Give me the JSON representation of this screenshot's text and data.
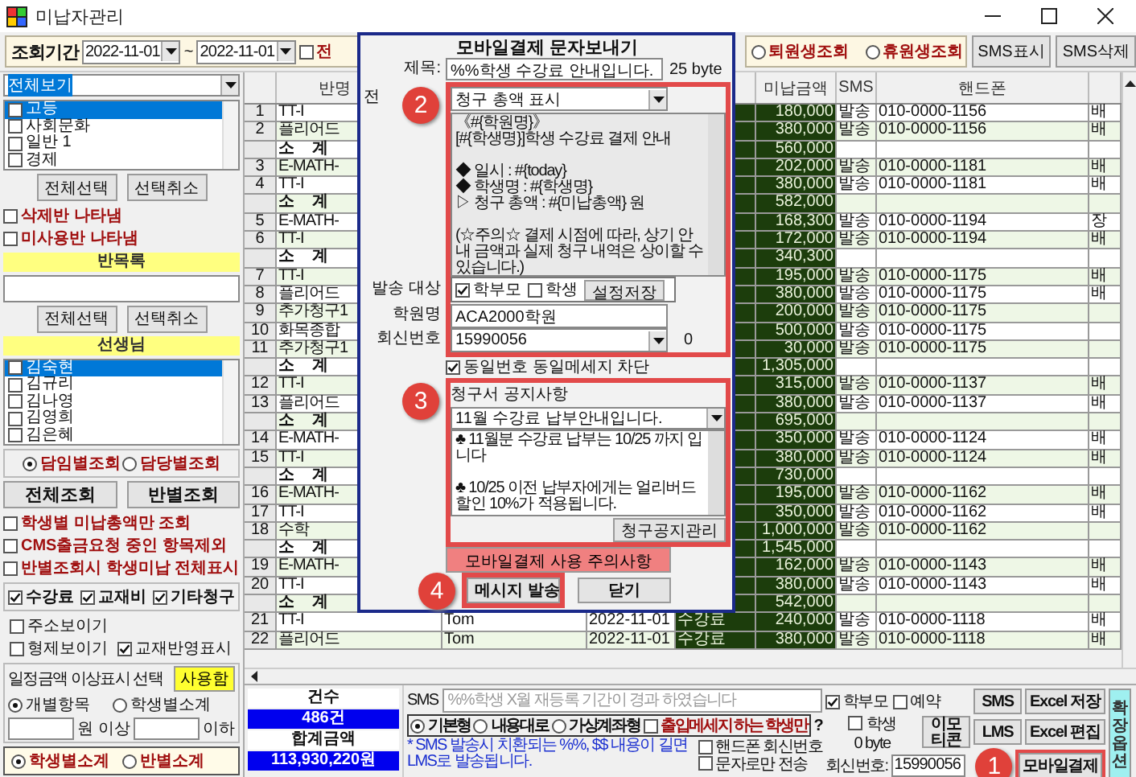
{
  "window": {
    "title": "미납자관리"
  },
  "toolbar": {
    "period_label": "조회기간",
    "date_from": "2022-11-01",
    "date_separator": "~",
    "date_to": "2022-11-01",
    "checkbox": {
      "label": "전",
      "checked": false
    },
    "radios": [
      {
        "label": "퇴원생조회",
        "selected": false
      },
      {
        "label": "휴원생조회",
        "selected": false
      }
    ],
    "buttons": [
      "SMS표시",
      "SMS삭제"
    ]
  },
  "left": {
    "filter": "전체보기",
    "subjects": [
      {
        "label": "고등",
        "checked": false,
        "selected": true
      },
      {
        "label": "사회문화",
        "checked": false,
        "selected": false
      },
      {
        "label": "일반 1",
        "checked": false,
        "selected": false
      },
      {
        "label": "경제",
        "checked": false,
        "selected": false
      }
    ],
    "subject_buttons": [
      "전체선택",
      "선택취소"
    ],
    "class_options": [
      {
        "label": "삭제반 나타냄",
        "checked": false
      },
      {
        "label": "미사용반 나타냄",
        "checked": false
      }
    ],
    "class_list_title": "반목록",
    "class_buttons": [
      "전체선택",
      "선택취소"
    ],
    "teacher_title": "선생님",
    "teachers": [
      {
        "label": "김숙현",
        "checked": false,
        "selected": true
      },
      {
        "label": "김규리",
        "checked": false,
        "selected": false
      },
      {
        "label": "김나영",
        "checked": false,
        "selected": false
      },
      {
        "label": "김영희",
        "checked": false,
        "selected": false
      },
      {
        "label": "김은혜",
        "checked": false,
        "selected": false
      }
    ],
    "query_mode": [
      {
        "label": "담임별조회",
        "selected": true
      },
      {
        "label": "담당별조회",
        "selected": false
      }
    ],
    "query_buttons": [
      "전체조회",
      "반별조회"
    ],
    "query_options": [
      {
        "label": "학생별 미납총액만 조회",
        "checked": false
      },
      {
        "label": "CMS출금요청 중인 항목제외",
        "checked": false
      },
      {
        "label": "반별조회시 학생미납 전체표시",
        "checked": false
      }
    ],
    "fee_types": [
      {
        "label": "수강료",
        "checked": true
      },
      {
        "label": "교재비",
        "checked": true
      },
      {
        "label": "기타청구",
        "checked": true
      }
    ],
    "display_options": [
      {
        "label": "주소보이기",
        "checked": false
      },
      {
        "label": "형제보이기",
        "checked": false
      },
      {
        "label": "교재반영표시",
        "checked": true
      }
    ],
    "threshold": {
      "title": "일정금액 이상표시 선택",
      "button": "사용함",
      "modes": [
        {
          "label": "개별항목",
          "selected": true
        },
        {
          "label": "학생별소계",
          "selected": false
        }
      ],
      "min_suffix": "원 이상",
      "max_suffix": "이하"
    },
    "subtotal_mode": [
      {
        "label": "학생별소계",
        "selected": true
      },
      {
        "label": "반별소계",
        "selected": false
      }
    ]
  },
  "table": {
    "columns": {
      "class": "반명",
      "amount": "미납금액",
      "sms": "SMS",
      "phone": "핸드폰"
    },
    "rows": [
      {
        "kind": "item",
        "no": "1",
        "class": "TT-I",
        "amount": "180,000",
        "sms": "발송",
        "phone": "010-0000-1156",
        "column_9": "배"
      },
      {
        "kind": "item",
        "no": "2",
        "class": "플리어드",
        "amount": "380,000",
        "sms": "발송",
        "phone": "010-0000-1156",
        "column_9": "배"
      },
      {
        "kind": "subtotal",
        "class": "소 계",
        "amount": "560,000"
      },
      {
        "kind": "item",
        "no": "3",
        "class": "E-MATH-",
        "amount": "202,000",
        "sms": "발송",
        "phone": "010-0000-1181",
        "column_9": "배"
      },
      {
        "kind": "item",
        "no": "4",
        "class": "TT-I",
        "amount": "380,000",
        "sms": "발송",
        "phone": "010-0000-1181",
        "column_9": "배"
      },
      {
        "kind": "subtotal",
        "class": "소 계",
        "amount": "582,000"
      },
      {
        "kind": "item",
        "no": "5",
        "class": "E-MATH-",
        "amount": "168,300",
        "sms": "발송",
        "phone": "010-0000-1194",
        "column_9": "장"
      },
      {
        "kind": "item",
        "no": "6",
        "class": "TT-I",
        "amount": "172,000",
        "sms": "발송",
        "phone": "010-0000-1194",
        "column_9": "배"
      },
      {
        "kind": "subtotal",
        "class": "소 계",
        "amount": "340,300"
      },
      {
        "kind": "item",
        "no": "7",
        "class": "TT-I",
        "amount": "195,000",
        "sms": "발송",
        "phone": "010-0000-1175",
        "column_9": "배"
      },
      {
        "kind": "item",
        "no": "8",
        "class": "플리어드",
        "amount": "380,000",
        "sms": "발송",
        "phone": "010-0000-1175",
        "column_9": "배"
      },
      {
        "kind": "item",
        "no": "9",
        "class": "추가청구1",
        "amount": "200,000",
        "sms": "발송",
        "phone": "010-0000-1175"
      },
      {
        "kind": "item",
        "no": "10",
        "class": "화목종합",
        "amount": "500,000",
        "sms": "발송",
        "phone": "010-0000-1175"
      },
      {
        "kind": "item",
        "no": "11",
        "class": "추가청구1",
        "amount": "30,000",
        "sms": "발송",
        "phone": "010-0000-1175"
      },
      {
        "kind": "subtotal",
        "class": "소 계",
        "amount": "1,305,000"
      },
      {
        "kind": "item",
        "no": "12",
        "class": "TT-I",
        "amount": "315,000",
        "sms": "발송",
        "phone": "010-0000-1137",
        "column_9": "배"
      },
      {
        "kind": "item",
        "no": "13",
        "class": "플리어드",
        "amount": "380,000",
        "sms": "발송",
        "phone": "010-0000-1137",
        "column_9": "배"
      },
      {
        "kind": "subtotal",
        "class": "소 계",
        "amount": "695,000"
      },
      {
        "kind": "item",
        "no": "14",
        "class": "E-MATH-",
        "amount": "350,000",
        "sms": "발송",
        "phone": "010-0000-1124",
        "column_9": "배"
      },
      {
        "kind": "item",
        "no": "15",
        "class": "TT-I",
        "amount": "380,000",
        "sms": "발송",
        "phone": "010-0000-1124",
        "column_9": "배"
      },
      {
        "kind": "subtotal",
        "class": "소 계",
        "amount": "730,000"
      },
      {
        "kind": "item",
        "no": "16",
        "class": "E-MATH-",
        "amount": "195,000",
        "sms": "발송",
        "phone": "010-0000-1162",
        "column_9": "배"
      },
      {
        "kind": "item",
        "no": "17",
        "class": "TT-I",
        "amount": "350,000",
        "sms": "발송",
        "phone": "010-0000-1162",
        "column_9": "배"
      },
      {
        "kind": "item",
        "no": "18",
        "class": "수학",
        "amount": "1,000,000",
        "sms": "발송",
        "phone": "010-0000-1162"
      },
      {
        "kind": "subtotal",
        "class": "소 계",
        "amount": "1,545,000"
      },
      {
        "kind": "item",
        "no": "19",
        "class": "E-MATH-",
        "amount": "162,000",
        "sms": "발송",
        "phone": "010-0000-1143",
        "column_9": "배"
      },
      {
        "kind": "item",
        "no": "20",
        "class": "TT-I",
        "amount": "380,000",
        "sms": "발송",
        "phone": "010-0000-1143",
        "column_9": "배"
      },
      {
        "kind": "subtotal",
        "class": "소 계",
        "amount": "542,000"
      },
      {
        "kind": "item",
        "no": "21",
        "class": "TT-I",
        "teacher": "Tom",
        "date": "2022-11-01",
        "item": "수강료",
        "amount": "240,000",
        "sms": "발송",
        "phone": "010-0000-1118",
        "column_9": "배"
      },
      {
        "kind": "item",
        "no": "22",
        "class": "플리어드",
        "teacher": "Tom",
        "date": "2022-11-01",
        "item": "수강료",
        "amount": "380,000",
        "sms": "발송",
        "phone": "010-0000-1118",
        "column_9": "배"
      }
    ]
  },
  "summary": {
    "count_label": "건수",
    "count": "486건",
    "total_label": "합계금액",
    "total": "113,930,220원"
  },
  "sms_panel": {
    "label": "SMS",
    "placeholder": "%%학생 X월 재등록 기간이 경과 하였습니다",
    "types": [
      {
        "label": "기본형",
        "selected": true
      },
      {
        "label": "내용대로",
        "selected": false
      },
      {
        "label": "가상계좌형",
        "selected": false
      }
    ],
    "entry_only": {
      "label": "출입메세지 하는 학생만",
      "checked": false
    },
    "help": "?",
    "note": "* SMS 발송시 치환되는 %%, $$ 내용이 길면 LMS로 발송됩니다.",
    "options": [
      {
        "label": "핸드폰 회신번호",
        "checked": false
      },
      {
        "label": "문자로만 전송",
        "checked": false
      }
    ],
    "recipients": [
      {
        "label": "학부모",
        "checked": true
      },
      {
        "label": "예약",
        "checked": false
      },
      {
        "label": "학생",
        "checked": false
      }
    ],
    "byte_count": "0 byte",
    "callback_label": "회신번호:",
    "callback": "15990056",
    "sms_button": "SMS",
    "lms_button": "LMS",
    "emoticon_button": "이모티콘",
    "excel_save_button": "Excel 저장",
    "excel_edit_button": "Excel 편집",
    "mobile_pay_button": "모바일결제",
    "side_button": "확장옵션"
  },
  "dialog": {
    "title": "모바일결제 문자보내기",
    "subject_label": "제목:",
    "subject": "%%학생 수강료 안내입니다.",
    "byte_count": "25 byte",
    "template_label": "전",
    "template": "청구 총액 표시",
    "message": "《#{학원명}》\n[#{학생명}]학생 수강료 결제 안내\n\n◆ 일시 : #{today}\n◆ 학생명 : #{학생명}\n▷ 청구 총액 : #{미납총액} 원\n\n(☆주의☆ 결제 시점에 따라, 상기 안내 금액과 실제 청구 내역은 상이할 수 있습니다.)",
    "target_label": "발송 대상",
    "targets": [
      {
        "label": "학부모",
        "checked": true
      },
      {
        "label": "학생",
        "checked": false
      }
    ],
    "save_button": "설정저장",
    "academy_label": "학원명",
    "academy": "ACA2000학원",
    "callback_label": "회신번호",
    "callback": "15990056",
    "callback_count": "0",
    "block_duplicate": {
      "label": "동일번호 동일메세지 차단",
      "checked": true
    },
    "notice_title": "청구서 공지사항",
    "notice": "11월 수강료 납부안내입니다.",
    "notice_text": "♣ 11월분 수강료 납부는 10/25 까지 입니다\n\n♣ 10/25 이전 납부자에게는 얼리버드 할인 10%가 적용됩니다.",
    "notice_button": "청구공지관리",
    "caution_button": "모바일결제 사용 주의사항",
    "send_button": "메시지 발송",
    "close_button": "닫기"
  },
  "callouts": [
    "1",
    "2",
    "3",
    "4"
  ]
}
